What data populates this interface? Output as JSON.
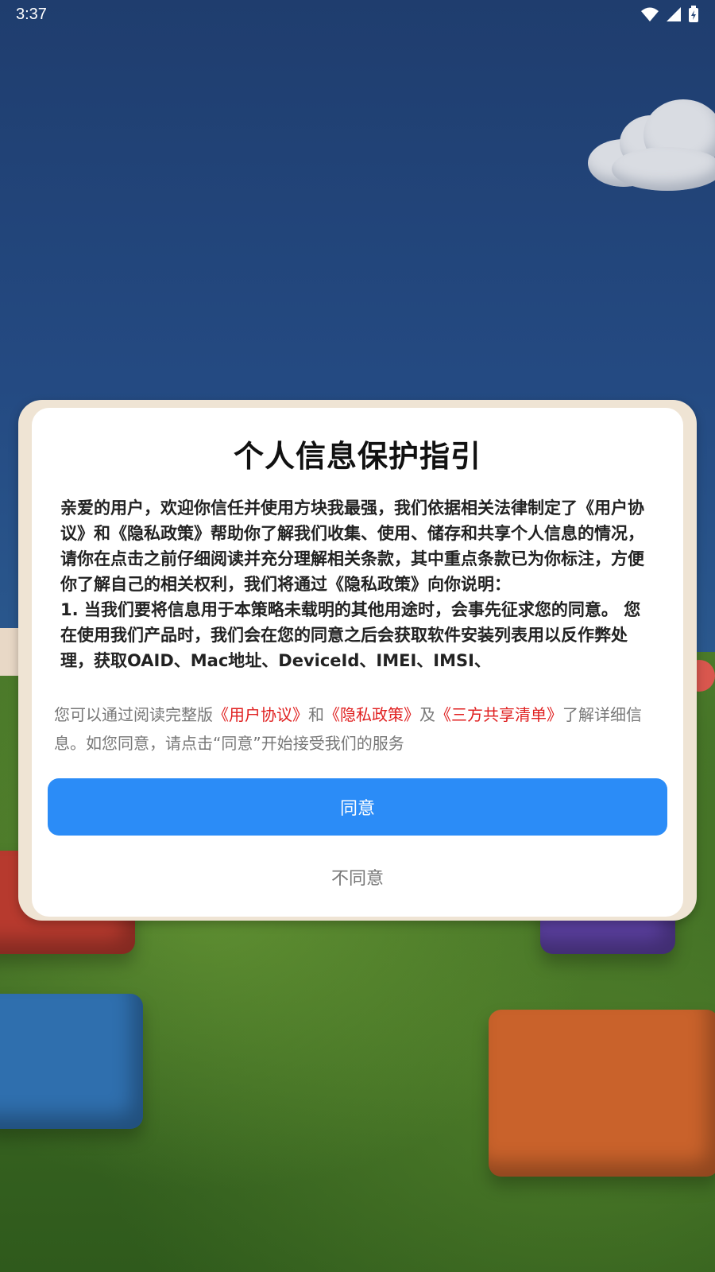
{
  "status_bar": {
    "time": "3:37",
    "icons": [
      "wifi-icon",
      "signal-icon",
      "battery-icon"
    ]
  },
  "dialog": {
    "title": "个人信息保护指引",
    "policy_paragraphs": [
      "亲爱的用户，欢迎你信任并使用方块我最强，我们依据相关法律制定了《用户协议》和《隐私政策》帮助你了解我们收集、使用、储存和共享个人信息的情况，请你在点击之前仔细阅读并充分理解相关条款，其中重点条款已为你标注，方便你了解自己的相关权利，我们将通过《隐私政策》向你说明：",
      "1. 当我们要将信息用于本策略未载明的其他用途时，会事先征求您的同意。 您在使用我们产品时，我们会在您的同意之后会获取软件安装列表用以反作弊处理，获取OAID、Mac地址、DeviceId、IMEI、IMSI、"
    ],
    "summary": {
      "prefix": "您可以通过阅读完整版",
      "link_user_agreement": "《用户协议》",
      "and": "和",
      "link_privacy_policy": "《隐私政策》",
      "also": "及",
      "link_third_party_list": "《三方共享清单》",
      "suffix": "了解详细信息。如您同意，请点击“同意”开始接受我们的服务"
    },
    "agree_label": "同意",
    "disagree_label": "不同意"
  },
  "colors": {
    "accent": "#2b8cf7",
    "link": "#e02020",
    "frame": "#efe4d4"
  }
}
